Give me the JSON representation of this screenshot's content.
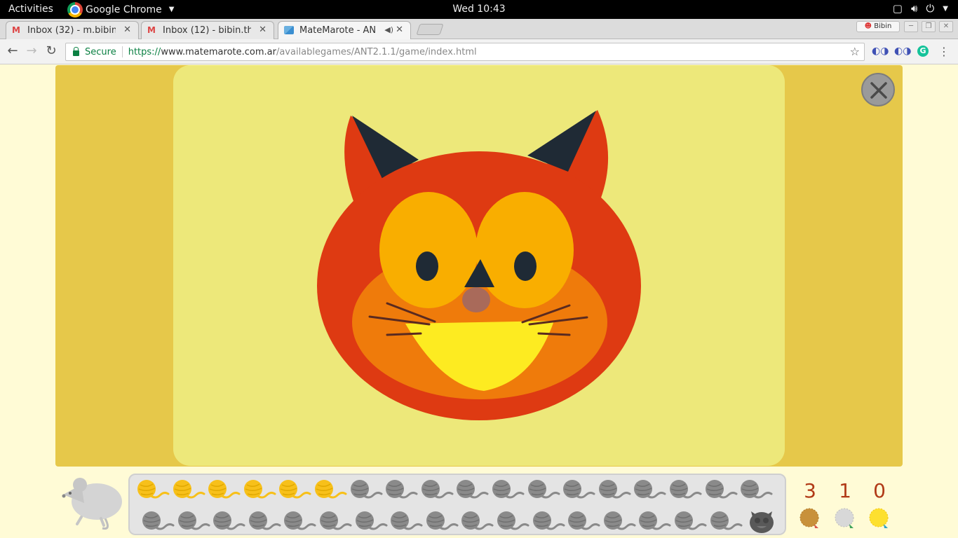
{
  "topbar": {
    "activities": "Activities",
    "app_name": "Google Chrome",
    "clock": "Wed 10:43"
  },
  "tabs": [
    {
      "label": "Inbox (32) - m.bibin",
      "icon": "gmail-icon"
    },
    {
      "label": "Inbox (12) - bibin.th",
      "icon": "gmail-icon"
    },
    {
      "label": "MateMarote - AN",
      "icon": "matemarote-icon",
      "active": true
    }
  ],
  "profile_label": "Bibin",
  "address_bar": {
    "secure_label": "Secure",
    "url_scheme": "https://",
    "url_host": "www.matemarote.com.ar",
    "url_path": "/availablegames/ANT2.1.1/game/index.html"
  },
  "game": {
    "balls_total": 35,
    "balls_filled": 6,
    "scores": [
      {
        "value": "3",
        "medal": "bronze",
        "color": "#c8913a"
      },
      {
        "value": "1",
        "medal": "silver",
        "color": "#d8d8d8"
      },
      {
        "value": "0",
        "medal": "gold",
        "color": "#fde02f"
      }
    ],
    "colors": {
      "yarn_filled": "#f7c01a",
      "yarn_empty": "#8a8a8a",
      "cat_face": "#de3a12",
      "cat_muzzle": "#ef7b0b",
      "cat_eyes": "#f9ae00",
      "cat_mouth": "#fdeb21"
    }
  }
}
